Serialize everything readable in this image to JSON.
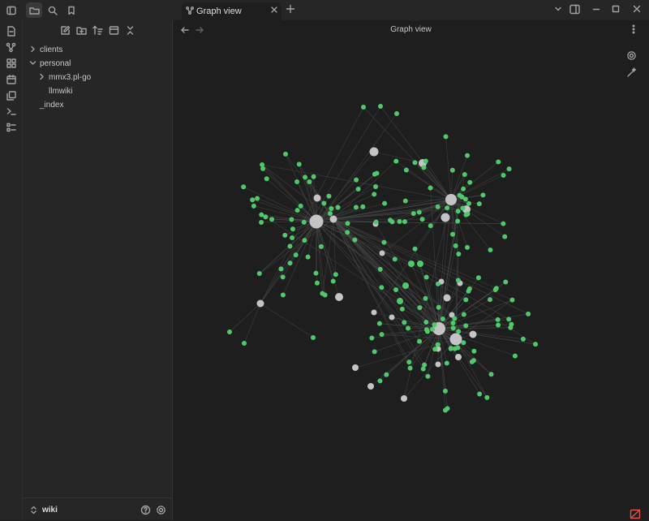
{
  "tab": {
    "title": "Graph view"
  },
  "header": {
    "title": "Graph view"
  },
  "file_tree": {
    "items": [
      {
        "label": "clients",
        "type": "folder",
        "expanded": false,
        "depth": 0
      },
      {
        "label": "personal",
        "type": "folder",
        "expanded": true,
        "depth": 0
      },
      {
        "label": "mmx3.pl-go",
        "type": "folder",
        "expanded": false,
        "depth": 1
      },
      {
        "label": "llmwiki",
        "type": "file",
        "depth": 1
      },
      {
        "label": "_index",
        "type": "file",
        "depth": 0
      }
    ]
  },
  "vault": {
    "name": "wiki"
  },
  "colors": {
    "background": "#1e1e1e",
    "panel": "#262626",
    "node_note": "#4fca6a",
    "node_hub": "#c4c4c4",
    "edge": "#4a4a4a",
    "accent_status": "#e05252"
  },
  "icons": {
    "topbar": [
      "sidebar-toggle-icon",
      "folder-icon",
      "search-icon",
      "bookmark-icon",
      "chevron-down-icon",
      "sidebar-right-icon",
      "minimize-icon",
      "maximize-icon",
      "close-icon"
    ],
    "ribbon": [
      "open-quick-switcher-icon",
      "graph-icon",
      "canvas-icon",
      "daily-note-icon",
      "templates-icon",
      "terminal-icon",
      "command-palette-icon"
    ],
    "nav_tools": [
      "new-note-icon",
      "new-folder-icon",
      "sort-icon",
      "auto-reveal-icon",
      "collapse-all-icon"
    ],
    "graph_controls": [
      "graph-settings-icon",
      "animate-icon"
    ]
  }
}
